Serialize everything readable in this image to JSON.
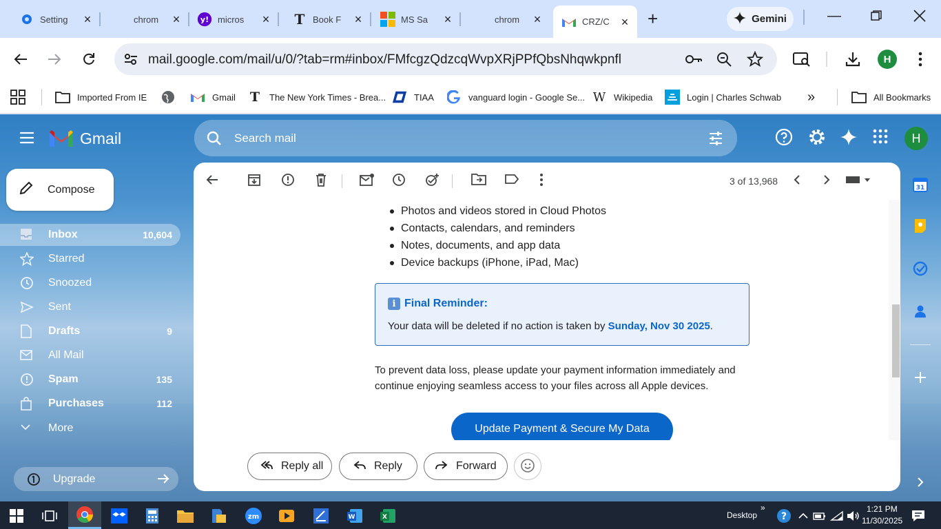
{
  "browser": {
    "tabs": [
      {
        "title": "Setting",
        "icon": "gear-icon"
      },
      {
        "title": "chrom",
        "icon": "none"
      },
      {
        "title": "micros",
        "icon": "yahoo-icon"
      },
      {
        "title": "Book F",
        "icon": "nyt-icon"
      },
      {
        "title": "MS Sa",
        "icon": "microsoft-icon"
      },
      {
        "title": "chrom",
        "icon": "none"
      },
      {
        "title": "CRZ/C",
        "icon": "gmail-icon",
        "active": true
      }
    ],
    "gemini_label": "Gemini",
    "url": "mail.google.com/mail/u/0/?tab=rm#inbox/FMfcgzQdzcqWvpXRjPPfQbsNhqwkpnfl",
    "profile_initial": "H"
  },
  "bookmarks": {
    "items": [
      {
        "label": "Imported From IE",
        "icon": "folder-icon"
      },
      {
        "label": "",
        "icon": "globe-icon"
      },
      {
        "label": "Gmail",
        "icon": "gmail-icon"
      },
      {
        "label": "The New York Times - Brea...",
        "icon": "nyt-icon"
      },
      {
        "label": "TIAA",
        "icon": "tiaa-icon"
      },
      {
        "label": "vanguard login - Google Se...",
        "icon": "google-icon"
      },
      {
        "label": "Wikipedia",
        "icon": "wikipedia-icon"
      },
      {
        "label": "Login | Charles Schwab",
        "icon": "schwab-icon"
      }
    ],
    "all_label": "All Bookmarks"
  },
  "gmail": {
    "brand": "Gmail",
    "search_placeholder": "Search mail",
    "compose_label": "Compose",
    "profile_initial": "H",
    "nav": [
      {
        "label": "Inbox",
        "count": "10,604",
        "icon": "inbox-icon",
        "bold": true,
        "selected": true
      },
      {
        "label": "Starred",
        "count": "",
        "icon": "star-icon"
      },
      {
        "label": "Snoozed",
        "count": "",
        "icon": "clock-icon"
      },
      {
        "label": "Sent",
        "count": "",
        "icon": "send-icon"
      },
      {
        "label": "Drafts",
        "count": "9",
        "icon": "draft-icon",
        "bold": true
      },
      {
        "label": "All Mail",
        "count": "",
        "icon": "all-mail-icon"
      },
      {
        "label": "Spam",
        "count": "135",
        "icon": "spam-icon",
        "bold": true
      },
      {
        "label": "Purchases",
        "count": "112",
        "icon": "purchases-icon",
        "bold": true
      },
      {
        "label": "More",
        "count": "",
        "icon": "chevron-down-icon"
      }
    ],
    "upgrade_label": "Upgrade",
    "message": {
      "counter": "3 of 13,968",
      "bullets": [
        "Photos and videos stored in Cloud Photos",
        "Contacts, calendars, and reminders",
        "Notes, documents, and app data",
        "Device backups (iPhone, iPad, Mac)"
      ],
      "reminder_title": "Final Reminder:",
      "reminder_text": "Your data will be deleted if no action is taken by",
      "reminder_date": "Sunday, Nov 30 2025",
      "reminder_end": ".",
      "paragraph": "To prevent data loss, please update your payment information immediately and continue enjoying seamless access to your files across all Apple devices.",
      "cta_label": "Update Payment & Secure My Data"
    },
    "actions": {
      "reply_all": "Reply all",
      "reply": "Reply",
      "forward": "Forward"
    }
  },
  "taskbar": {
    "desktop_label": "Desktop",
    "time": "1:21 PM",
    "date": "11/30/2025"
  },
  "colors": {
    "accent_blue": "#0a66c9",
    "gmail_green": "#1e8e3e",
    "tab_strip": "#d3e3fd"
  }
}
